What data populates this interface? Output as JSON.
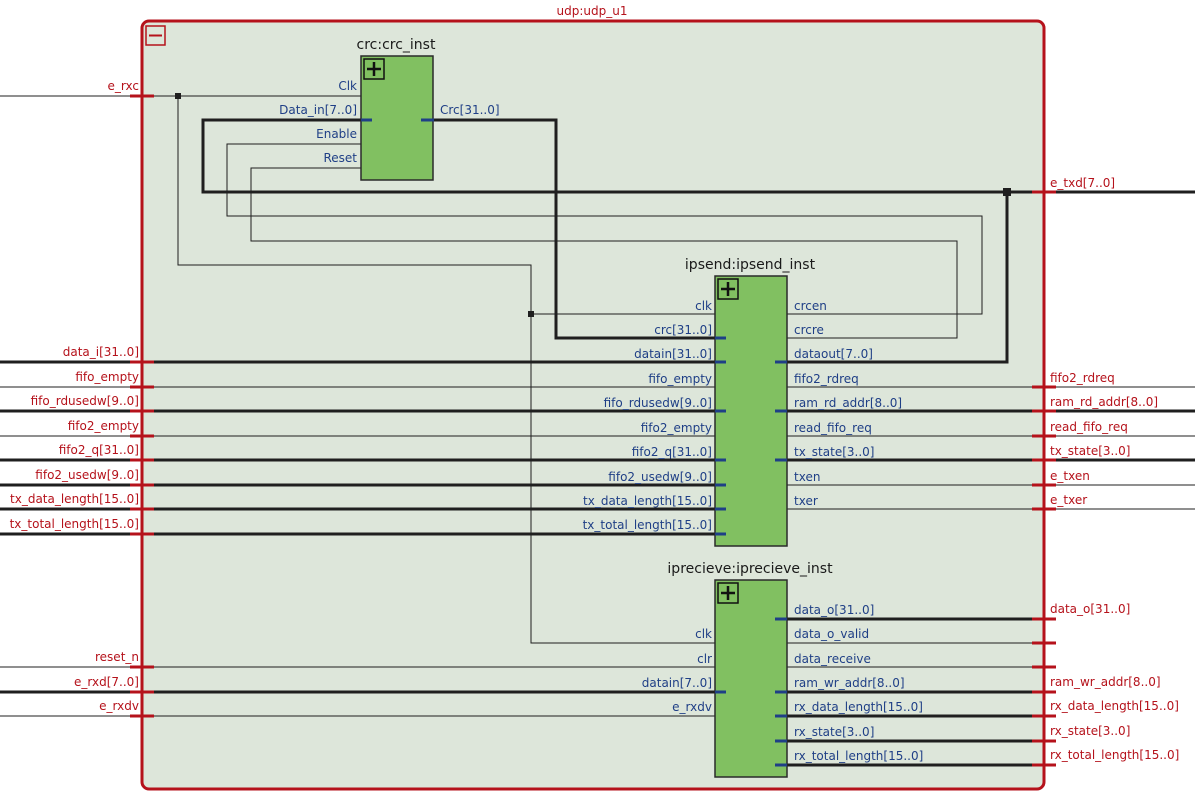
{
  "outer": {
    "title": "udp:udp_u1",
    "left_ports": [
      "e_rxc",
      "data_i[31..0]",
      "fifo_empty",
      "fifo_rdusedw[9..0]",
      "fifo2_empty",
      "fifo2_q[31..0]",
      "fifo2_usedw[9..0]",
      "tx_data_length[15..0]",
      "tx_total_length[15..0]",
      "reset_n",
      "e_rxd[7..0]",
      "e_rxdv"
    ],
    "right_ports": [
      "e_txd[7..0]",
      "fifo2_rdreq",
      "ram_rd_addr[8..0]",
      "read_fifo_req",
      "tx_state[3..0]",
      "e_txen",
      "e_txer",
      "data_o[31..0]",
      "ram_wr_addr[8..0]",
      "rx_data_length[15..0]",
      "rx_state[3..0]",
      "rx_total_length[15..0]"
    ]
  },
  "crc": {
    "title": "crc:crc_inst",
    "inputs": [
      "Clk",
      "Data_in[7..0]",
      "Enable",
      "Reset"
    ],
    "outputs": [
      "Crc[31..0]"
    ]
  },
  "ipsend": {
    "title": "ipsend:ipsend_inst",
    "inputs": [
      "clk",
      "crc[31..0]",
      "datain[31..0]",
      "fifo_empty",
      "fifo_rdusedw[9..0]",
      "fifo2_empty",
      "fifo2_q[31..0]",
      "fifo2_usedw[9..0]",
      "tx_data_length[15..0]",
      "tx_total_length[15..0]"
    ],
    "outputs": [
      "crcen",
      "crcre",
      "dataout[7..0]",
      "fifo2_rdreq",
      "ram_rd_addr[8..0]",
      "read_fifo_req",
      "tx_state[3..0]",
      "txen",
      "txer"
    ]
  },
  "iprecieve": {
    "title": "iprecieve:iprecieve_inst",
    "inputs": [
      "clk",
      "clr",
      "datain[7..0]",
      "e_rxdv"
    ],
    "outputs": [
      "data_o[31..0]",
      "data_o_valid",
      "data_receive",
      "ram_wr_addr[8..0]",
      "rx_data_length[15..0]",
      "rx_state[3..0]",
      "rx_total_length[15..0]"
    ]
  },
  "colors": {
    "outer_border": "#b5121b",
    "outer_fill": "#dde6da",
    "block_fill": "#81c061",
    "port_text_outer": "#b5121b",
    "port_text_inner": "#1f3f86"
  },
  "icons": {
    "collapse": "minus-box-icon",
    "expand": "plus-box-icon"
  }
}
